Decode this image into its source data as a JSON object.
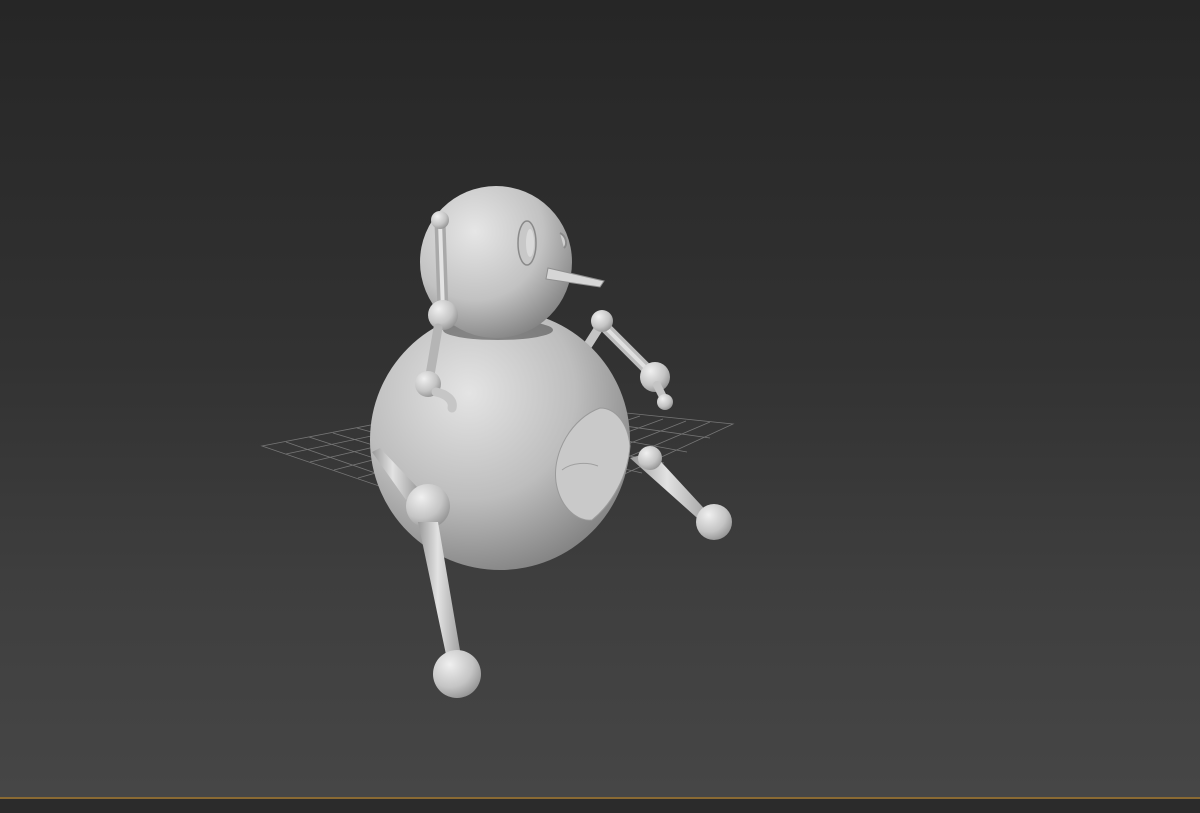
{
  "viewport": {
    "background_top": "#262626",
    "background_bottom": "#464646",
    "border_color": "#8a6a33",
    "grid_color": "#8c8c8c",
    "model_color": "#cfcfcf"
  },
  "model": {
    "name": "snowman",
    "parts": [
      "head",
      "body",
      "nose",
      "eye",
      "arm-left",
      "arm-right",
      "leg-left",
      "leg-right",
      "hand-left",
      "hand-right",
      "foot-left",
      "foot-right",
      "belly-patch"
    ]
  }
}
